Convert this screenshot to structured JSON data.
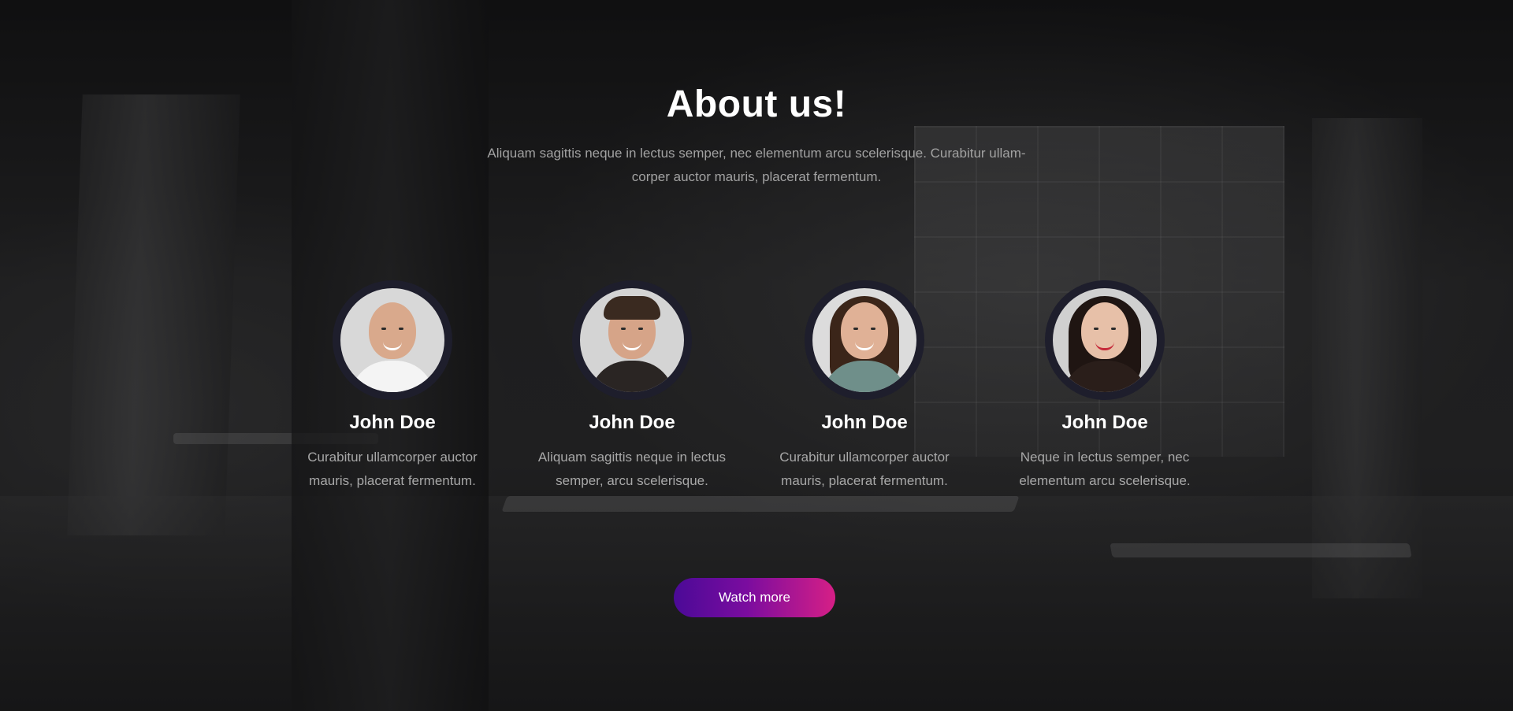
{
  "section": {
    "title": "About us!",
    "subtitle": "Aliquam sagittis neque in lectus semper, nec elementum arcu scelerisque. Curabitur ullam-corper auctor mauris, placerat fermentum."
  },
  "team": [
    {
      "name": "John Doe",
      "description": "Curabitur ullamcorper auctor mauris, placerat fermentum.",
      "avatar": "bald-man-white-shirt"
    },
    {
      "name": "John Doe",
      "description": "Aliquam sagittis neque in lectus semper, arcu scelerisque.",
      "avatar": "man-dark-suit-tie"
    },
    {
      "name": "John Doe",
      "description": "Curabitur ullamcorper auctor mauris, placerat fermentum.",
      "avatar": "woman-long-hair-plaid-shirt"
    },
    {
      "name": "John Doe",
      "description": "Neque in lectus semper, nec elementum arcu scelerisque.",
      "avatar": "woman-dark-hair-red-lips"
    }
  ],
  "cta": {
    "label": "Watch more"
  },
  "colors": {
    "title": "#ffffff",
    "text_muted": "#a8a8a8",
    "avatar_ring": "#1e1e2c",
    "button_gradient_start": "#4b0a97",
    "button_gradient_end": "#d61f86"
  }
}
